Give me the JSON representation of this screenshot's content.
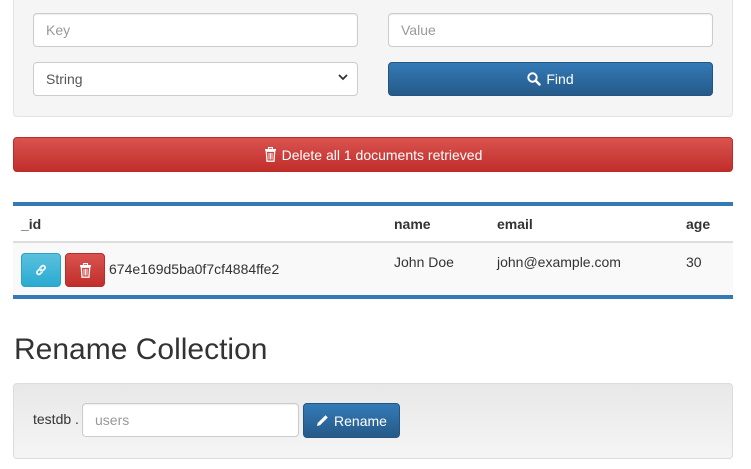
{
  "query_form": {
    "key_placeholder": "Key",
    "value_placeholder": "Value",
    "type_selected": "String",
    "find_label": "Find"
  },
  "delete_all_label": "Delete all 1 documents retrieved",
  "table": {
    "headers": {
      "id": "_id",
      "name": "name",
      "email": "email",
      "age": "age"
    },
    "rows": [
      {
        "id": "674e169d5ba0f7cf4884ffe2",
        "name": "John Doe",
        "email": "john@example.com",
        "age": "30"
      }
    ]
  },
  "rename": {
    "heading": "Rename Collection",
    "db_prefix": "testdb .",
    "input_placeholder": "users",
    "button_label": "Rename"
  },
  "colors": {
    "primary": "#337ab7",
    "danger": "#d9534f",
    "info": "#5bc0de"
  },
  "icons": {
    "find": "search-icon",
    "delete_all": "trash-icon",
    "row_link": "link-icon",
    "row_delete": "trash-icon",
    "rename": "pencil-icon"
  }
}
